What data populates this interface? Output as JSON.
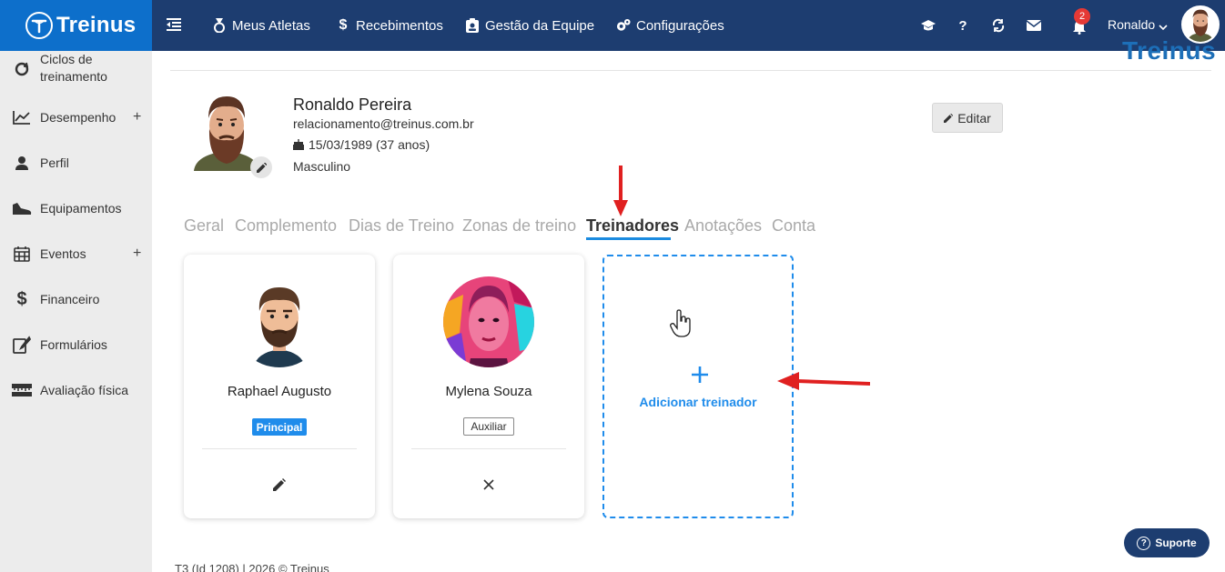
{
  "brand": {
    "name": "Treinus",
    "watermark": "Treinus"
  },
  "topnav": {
    "items": [
      {
        "label": "Meus Atletas",
        "icon": "medal-icon"
      },
      {
        "label": "Recebimentos",
        "icon": "dollar-icon"
      },
      {
        "label": "Gestão da Equipe",
        "icon": "id-card-icon"
      },
      {
        "label": "Configurações",
        "icon": "gears-icon"
      }
    ],
    "icons": [
      "graduation-cap-icon",
      "question-icon",
      "sync-icon",
      "envelope-icon",
      "bell-icon"
    ],
    "notification_count": "2",
    "user_name": "Ronaldo"
  },
  "sidebar": {
    "items": [
      {
        "label": "Ciclos de treinamento",
        "icon": "cycle-icon",
        "expandable": false
      },
      {
        "label": "Desempenho",
        "icon": "chart-line-icon",
        "expandable": true
      },
      {
        "label": "Perfil",
        "icon": "user-icon",
        "expandable": false
      },
      {
        "label": "Equipamentos",
        "icon": "shoe-icon",
        "expandable": false
      },
      {
        "label": "Eventos",
        "icon": "calendar-icon",
        "expandable": true
      },
      {
        "label": "Financeiro",
        "icon": "dollar-icon",
        "expandable": false
      },
      {
        "label": "Formulários",
        "icon": "form-edit-icon",
        "expandable": false
      },
      {
        "label": "Avaliação física",
        "icon": "ruler-icon",
        "expandable": false
      }
    ],
    "plus_symbol": "+"
  },
  "profile": {
    "name": "Ronaldo Pereira",
    "email": "relacionamento@treinus.com.br",
    "birth": "15/03/1989 (37 anos)",
    "gender": "Masculino",
    "edit_label": "Editar"
  },
  "tabs": {
    "items": [
      "Geral",
      "Complemento",
      "Dias de Treino",
      "Zonas de treino",
      "Treinadores",
      "Anotações",
      "Conta"
    ],
    "active": "Treinadores"
  },
  "trainers": [
    {
      "name": "Raphael Augusto",
      "role": "Principal",
      "action": "edit"
    },
    {
      "name": "Mylena Souza",
      "role": "Auxiliar",
      "action": "remove"
    }
  ],
  "add_trainer": {
    "plus": "+",
    "label": "Adicionar treinador"
  },
  "footer": {
    "text": "T3 (Id 1208) | 2026 © Treinus"
  },
  "support": {
    "label": "Suporte",
    "icon_glyph": "?"
  },
  "colors": {
    "topbar": "#1d3d70",
    "brand": "#0d6fcb",
    "accent": "#1f8ceb",
    "annotation_arrow": "#e02020"
  }
}
